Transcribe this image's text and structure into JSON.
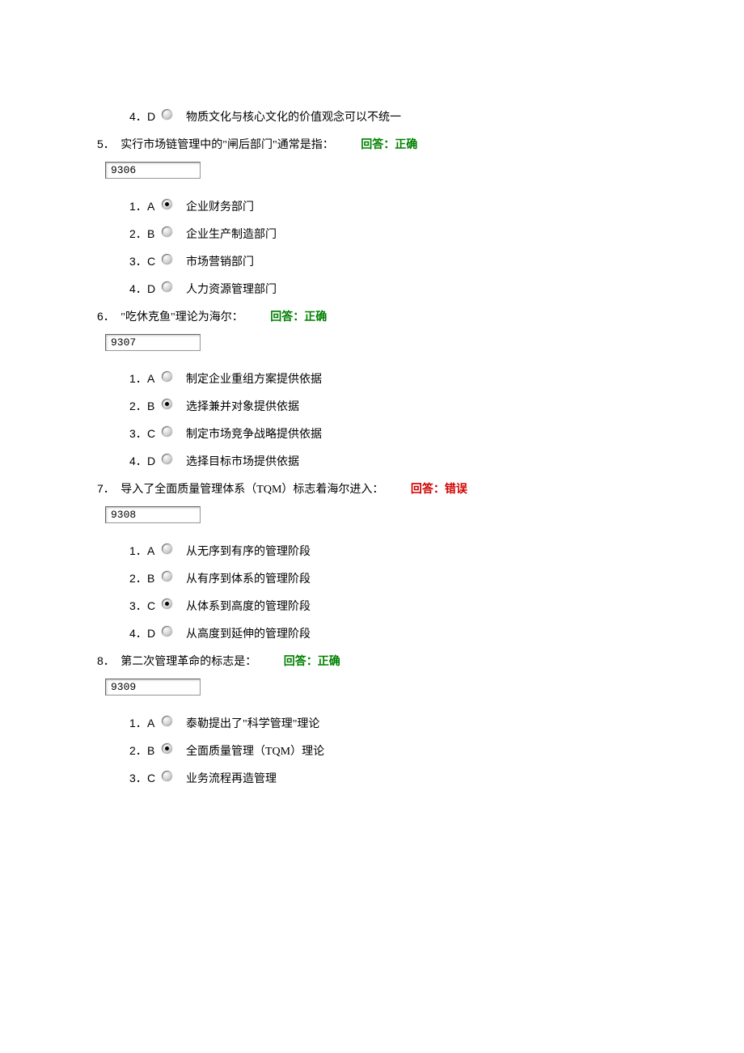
{
  "q4_prefix": {
    "option": {
      "num": "4．",
      "letter": "D",
      "selected": false,
      "text": "物质文化与核心文化的价值观念可以不统一"
    }
  },
  "questions": [
    {
      "num": "5．",
      "stem": "实行市场链管理中的\"闸后部门\"通常是指：",
      "feedback": "回答：正确",
      "feedback_type": "correct",
      "id_value": "9306",
      "options": [
        {
          "num": "1．",
          "letter": "A",
          "selected": true,
          "text": "企业财务部门"
        },
        {
          "num": "2．",
          "letter": "B",
          "selected": false,
          "text": "企业生产制造部门"
        },
        {
          "num": "3．",
          "letter": "C",
          "selected": false,
          "text": "市场营销部门"
        },
        {
          "num": "4．",
          "letter": "D",
          "selected": false,
          "text": "人力资源管理部门"
        }
      ]
    },
    {
      "num": "6．",
      "stem": "\"吃休克鱼\"理论为海尔：",
      "feedback": "回答：正确",
      "feedback_type": "correct",
      "id_value": "9307",
      "options": [
        {
          "num": "1．",
          "letter": "A",
          "selected": false,
          "text": "制定企业重组方案提供依据"
        },
        {
          "num": "2．",
          "letter": "B",
          "selected": true,
          "text": "选择兼并对象提供依据"
        },
        {
          "num": "3．",
          "letter": "C",
          "selected": false,
          "text": "制定市场竞争战略提供依据"
        },
        {
          "num": "4．",
          "letter": "D",
          "selected": false,
          "text": "选择目标市场提供依据"
        }
      ]
    },
    {
      "num": "7．",
      "stem": "导入了全面质量管理体系（TQM）标志着海尔进入：",
      "feedback": "回答：错误",
      "feedback_type": "wrong",
      "id_value": "9308",
      "options": [
        {
          "num": "1．",
          "letter": "A",
          "selected": false,
          "text": "从无序到有序的管理阶段"
        },
        {
          "num": "2．",
          "letter": "B",
          "selected": false,
          "text": "从有序到体系的管理阶段"
        },
        {
          "num": "3．",
          "letter": "C",
          "selected": true,
          "text": "从体系到高度的管理阶段"
        },
        {
          "num": "4．",
          "letter": "D",
          "selected": false,
          "text": "从高度到延伸的管理阶段"
        }
      ]
    },
    {
      "num": "8．",
      "stem": "第二次管理革命的标志是：",
      "feedback": "回答：正确",
      "feedback_type": "correct",
      "id_value": "9309",
      "options": [
        {
          "num": "1．",
          "letter": "A",
          "selected": false,
          "text": "泰勒提出了\"科学管理\"理论"
        },
        {
          "num": "2．",
          "letter": "B",
          "selected": true,
          "text": "全面质量管理（TQM）理论"
        },
        {
          "num": "3．",
          "letter": "C",
          "selected": false,
          "text": "业务流程再造管理"
        }
      ]
    }
  ]
}
